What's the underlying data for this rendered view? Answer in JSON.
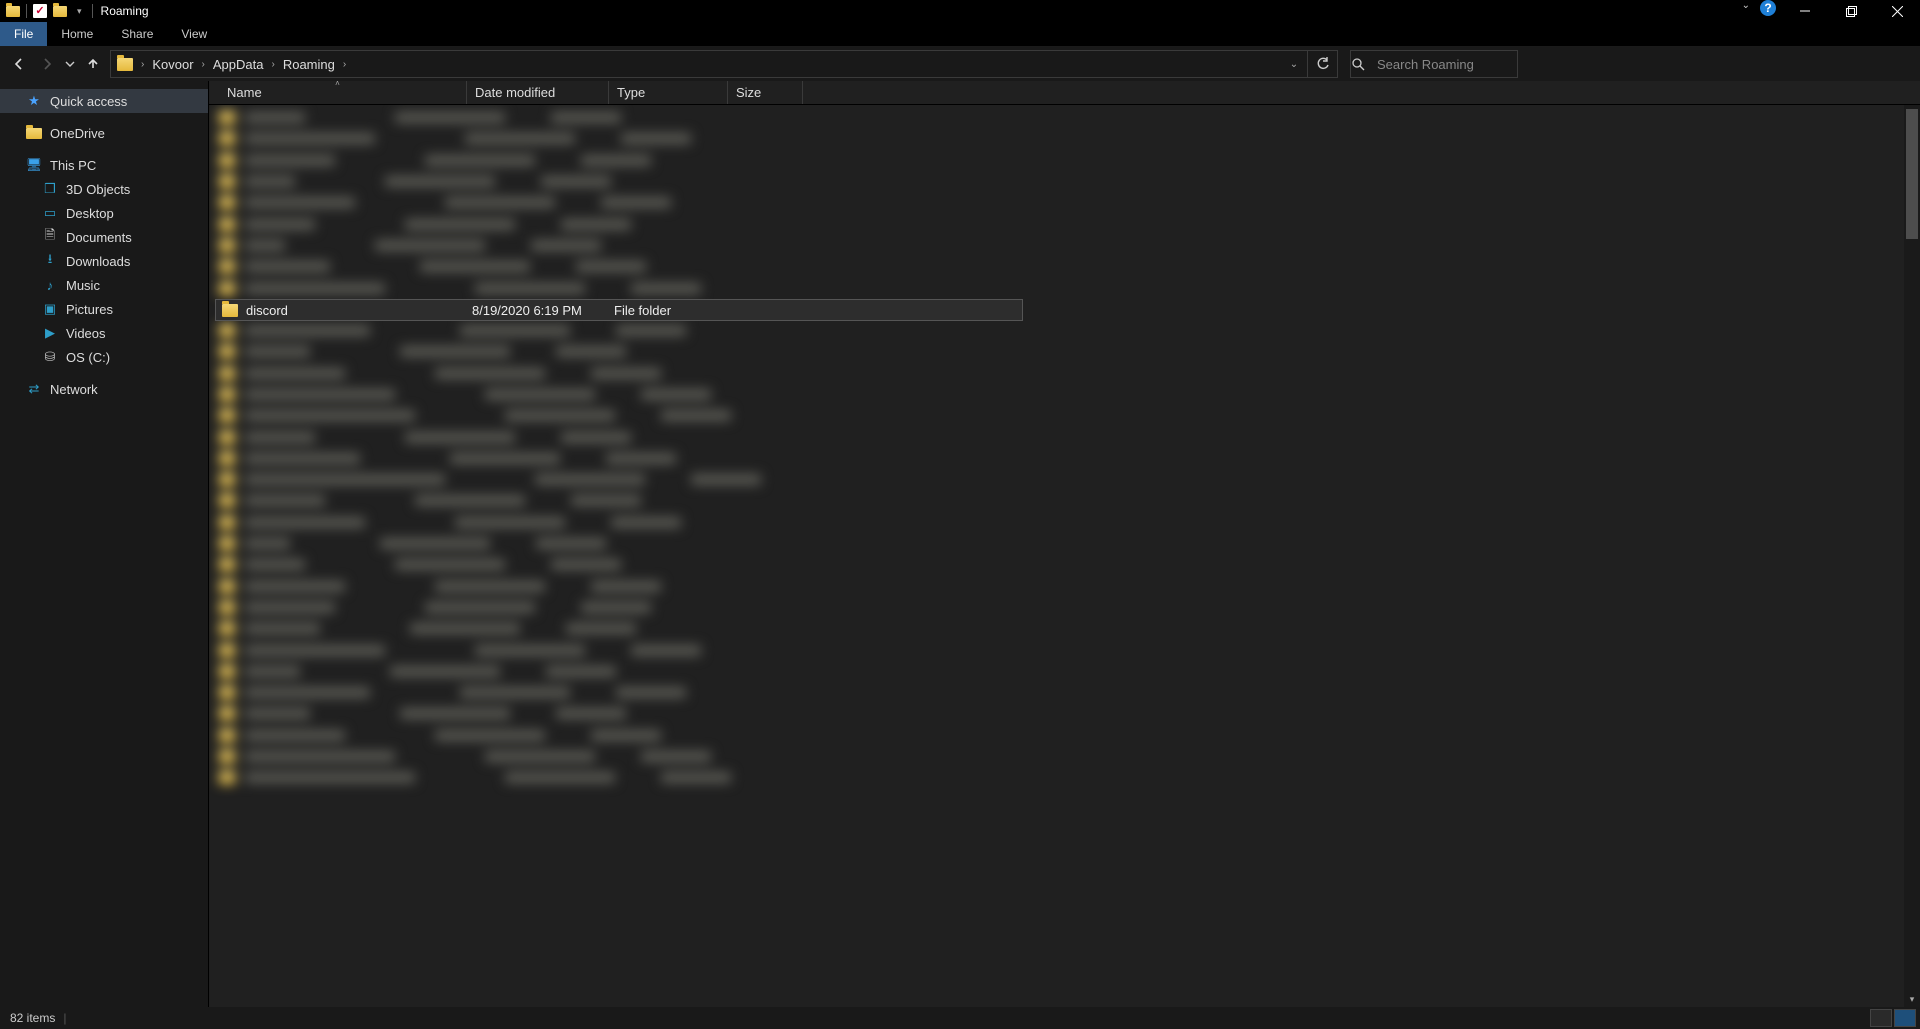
{
  "window": {
    "title": "Roaming"
  },
  "ribbon": {
    "tabs": {
      "file": "File",
      "home": "Home",
      "share": "Share",
      "view": "View"
    }
  },
  "breadcrumbs": {
    "seg0": "Kovoor",
    "seg1": "AppData",
    "seg2": "Roaming"
  },
  "search": {
    "placeholder": "Search Roaming"
  },
  "columns": {
    "name": "Name",
    "date": "Date modified",
    "type": "Type",
    "size": "Size"
  },
  "selected_row": {
    "name": "discord",
    "date": "8/19/2020 6:19 PM",
    "type": "File folder"
  },
  "navpane": {
    "quick_access": "Quick access",
    "onedrive": "OneDrive",
    "this_pc": "This PC",
    "objects3d": "3D Objects",
    "desktop": "Desktop",
    "documents": "Documents",
    "downloads": "Downloads",
    "music": "Music",
    "pictures": "Pictures",
    "videos": "Videos",
    "osc": "OS (C:)",
    "network": "Network"
  },
  "status": {
    "item_count": "82 items"
  }
}
